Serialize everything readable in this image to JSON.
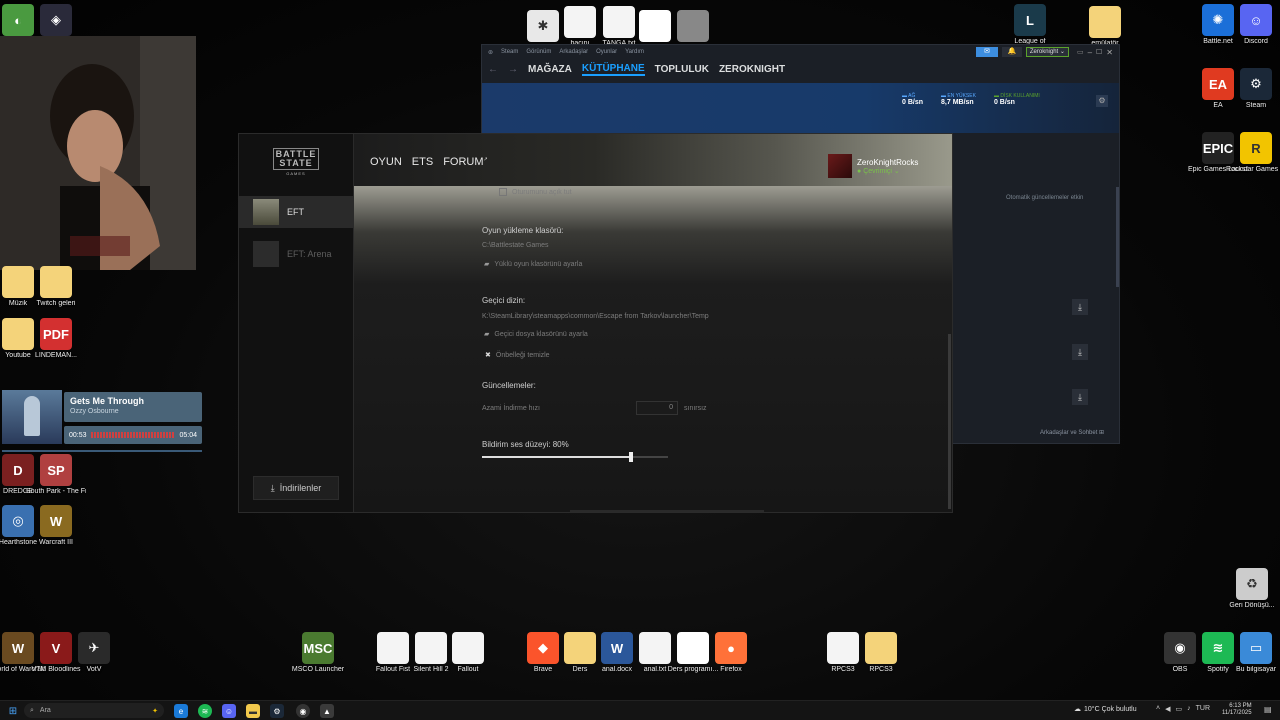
{
  "desktop": {
    "top_icons": [
      {
        "label": "",
        "color": "#4a9a40",
        "glyph": "◐"
      },
      {
        "label": "",
        "color": "#2a2a3a",
        "glyph": "◈"
      },
      {
        "label": "dene.png",
        "color": "#e8e8e8",
        "glyph": "✱"
      },
      {
        "label": "bacını",
        "color": "#f4f4f4",
        "glyph": ""
      },
      {
        "label": "TANGA.txt",
        "color": "#f4f4f4",
        "glyph": ""
      },
      {
        "label": "Çok Güzel",
        "color": "#ffffff",
        "glyph": ""
      },
      {
        "label": "YEGENİM...",
        "color": "#888888",
        "glyph": ""
      },
      {
        "label": "League of",
        "color": "#1a3a4a",
        "glyph": "L"
      },
      {
        "label": "emülatör",
        "color": "#f4d37a",
        "glyph": ""
      },
      {
        "label": "Battle.net",
        "color": "#1b6fd8",
        "glyph": "✺"
      },
      {
        "label": "Discord",
        "color": "#5865f2",
        "glyph": "☺"
      }
    ],
    "right_icons": [
      {
        "label": "EA",
        "color": "#e03a20",
        "glyph": "EA"
      },
      {
        "label": "Steam",
        "color": "#1b2838",
        "glyph": "⚙"
      },
      {
        "label": "Epic Games Launcher",
        "color": "#222222",
        "glyph": "EPIC"
      },
      {
        "label": "Rockstar Games ...",
        "color": "#f2c400",
        "glyph": "R"
      },
      {
        "label": "Geri Dönüşü...",
        "color": "#cccccc",
        "glyph": "♻"
      },
      {
        "label": "OBS",
        "color": "#333333",
        "glyph": "◉"
      },
      {
        "label": "Spotify",
        "color": "#1db954",
        "glyph": "≋"
      },
      {
        "label": "Bu bilgisayar",
        "color": "#3a8ad8",
        "glyph": "▭"
      }
    ],
    "left_icons": [
      {
        "label": "Müzik",
        "color": "#f4d37a",
        "glyph": ""
      },
      {
        "label": "Twitch geleri",
        "color": "#f4d37a",
        "glyph": ""
      },
      {
        "label": "Youtube",
        "color": "#f4d37a",
        "glyph": ""
      },
      {
        "label": "LINDEMAN...",
        "color": "#d33030",
        "glyph": "PDF"
      },
      {
        "label": "DREDGE",
        "color": "#7a2020",
        "glyph": "D"
      },
      {
        "label": "South Park - The Fractur...",
        "color": "#b04040",
        "glyph": "SP"
      },
      {
        "label": "Hearthstone",
        "color": "#3a70b0",
        "glyph": "◎"
      },
      {
        "label": "Warcraft III",
        "color": "#8a6a20",
        "glyph": "W"
      },
      {
        "label": "World of Warcraft",
        "color": "#6a4a20",
        "glyph": "W"
      },
      {
        "label": "VTM Bloodlines",
        "color": "#8a1a1a",
        "glyph": "V"
      },
      {
        "label": "VotV",
        "color": "#2a2a2a",
        "glyph": "✈"
      }
    ],
    "bottom_icons": [
      {
        "label": "MSCO Launcher",
        "color": "#4a7a30",
        "glyph": "MSC"
      },
      {
        "label": "Fallout Fist",
        "color": "#f4f4f4",
        "glyph": ""
      },
      {
        "label": "Silent Hill 2",
        "color": "#f4f4f4",
        "glyph": ""
      },
      {
        "label": "Fallout",
        "color": "#f4f4f4",
        "glyph": ""
      },
      {
        "label": "Brave",
        "color": "#fb542b",
        "glyph": "◆"
      },
      {
        "label": "Ders",
        "color": "#f4d37a",
        "glyph": ""
      },
      {
        "label": "anal.docx",
        "color": "#2b579a",
        "glyph": "W"
      },
      {
        "label": "anal.txt",
        "color": "#f4f4f4",
        "glyph": ""
      },
      {
        "label": "Ders programı...",
        "color": "#ffffff",
        "glyph": ""
      },
      {
        "label": "Firefox",
        "color": "#ff7139",
        "glyph": "●"
      },
      {
        "label": "RPCS3",
        "color": "#f4f4f4",
        "glyph": ""
      },
      {
        "label": "RPCS3",
        "color": "#f4d37a",
        "glyph": ""
      }
    ]
  },
  "spotify": {
    "title": "Gets Me Through",
    "artist": "Ozzy Osbourne",
    "elapsed": "00:53",
    "total": "05:04",
    "progress": 0.17
  },
  "steam": {
    "menu": [
      "Steam",
      "Görünüm",
      "Arkadaşlar",
      "Oyunlar",
      "Yardım"
    ],
    "nav": [
      "MAĞAZA",
      "KÜTÜPHANE",
      "TOPLULUK",
      "ZEROKNIGHT"
    ],
    "active_nav": "KÜTÜPHANE",
    "account": "Zeroknight",
    "stats": [
      {
        "label": "AĞ",
        "value": "0 B/sn"
      },
      {
        "label": "EN YÜKSEK",
        "value": "8,7 MB/sn"
      },
      {
        "label": "DİSK KULLANIMI",
        "value": "0 B/sn"
      }
    ],
    "auto_update_text": "Otomatik güncellemeler etkin",
    "friends_chat": "Arkadaşlar ve Sohbet"
  },
  "bsg": {
    "logo": "BATTLE STATE",
    "logo_sub": "GAMES",
    "nav": [
      "OYUN",
      "ETS",
      "FORUM"
    ],
    "user": {
      "name": "ZeroKnightRocks",
      "status": "Çevrimiçi"
    },
    "games": [
      {
        "label": "EFT",
        "active": true
      },
      {
        "label": "EFT: Arena",
        "active": false
      }
    ],
    "downloads_button": "İndirilenler",
    "settings": {
      "top_checkbox": "Oturumunu açık tut",
      "install_folder": {
        "label": "Oyun yükleme klasörü:",
        "path": "C:\\Battlestate Games",
        "action": "Yüklü oyun klasörünü ayarla"
      },
      "temp_folder": {
        "label": "Geçici dizin:",
        "path": "K:\\SteamLibrary\\steamapps\\common\\Escape from Tarkov\\launcher\\Temp",
        "action": "Geçici dosya klasörünü ayarla",
        "clear": "Önbelleği temizle"
      },
      "updates": {
        "label": "Güncellemeler:",
        "limit_label": "Azami İndirme hızı",
        "limit_value": "0",
        "limit_unit": "sınırsız"
      },
      "volume": {
        "label": "Bildirim ses düzeyi: 80%",
        "value": 0.8
      }
    }
  },
  "taskbar": {
    "search": "Ara",
    "weather": "10°C  Çok bulutlu",
    "lang": "TUR",
    "time": "6:13 PM",
    "date": "11/17/2025"
  }
}
